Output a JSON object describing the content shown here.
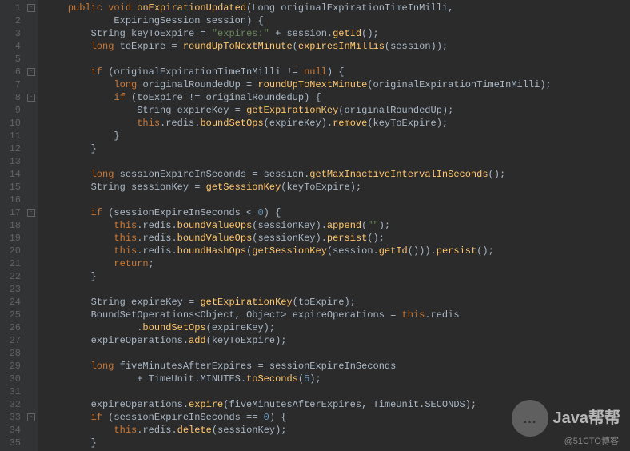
{
  "lineCount": 35,
  "foldMarks": [
    {
      "line": 1,
      "glyph": "-"
    },
    {
      "line": 6,
      "glyph": "-"
    },
    {
      "line": 8,
      "glyph": "-"
    },
    {
      "line": 17,
      "glyph": "-"
    },
    {
      "line": 33,
      "glyph": "-"
    }
  ],
  "code": [
    [
      [
        "    "
      ],
      [
        "kw",
        "public"
      ],
      [
        " "
      ],
      [
        "kw",
        "void"
      ],
      [
        " "
      ],
      [
        "mtd",
        "onExpirationUpdated"
      ],
      [
        "punc",
        "("
      ],
      [
        "cls",
        "Long"
      ],
      [
        " "
      ],
      [
        "param",
        "originalExpirationTimeInMilli"
      ],
      [
        "punc",
        ","
      ]
    ],
    [
      [
        "            "
      ],
      [
        "cls",
        "ExpiringSession"
      ],
      [
        " "
      ],
      [
        "param",
        "session"
      ],
      [
        "punc",
        ") {"
      ]
    ],
    [
      [
        "        "
      ],
      [
        "cls",
        "String"
      ],
      [
        " "
      ],
      [
        "id",
        "keyToExpire"
      ],
      [
        " = "
      ],
      [
        "str",
        "\"expires:\""
      ],
      [
        " + "
      ],
      [
        "id",
        "session"
      ],
      [
        "punc",
        "."
      ],
      [
        "mtd",
        "getId"
      ],
      [
        "punc",
        "();"
      ]
    ],
    [
      [
        "        "
      ],
      [
        "kw",
        "long"
      ],
      [
        " "
      ],
      [
        "id",
        "toExpire"
      ],
      [
        " = "
      ],
      [
        "mtd",
        "roundUpToNextMinute"
      ],
      [
        "punc",
        "("
      ],
      [
        "mtd",
        "expiresInMillis"
      ],
      [
        "punc",
        "("
      ],
      [
        "id",
        "session"
      ],
      [
        "punc",
        "));"
      ]
    ],
    [
      [
        ""
      ]
    ],
    [
      [
        "        "
      ],
      [
        "kw",
        "if"
      ],
      [
        " ("
      ],
      [
        "id",
        "originalExpirationTimeInMilli"
      ],
      [
        " != "
      ],
      [
        "kw",
        "null"
      ],
      [
        "punc",
        ") {"
      ]
    ],
    [
      [
        "            "
      ],
      [
        "kw",
        "long"
      ],
      [
        " "
      ],
      [
        "id",
        "originalRoundedUp"
      ],
      [
        " = "
      ],
      [
        "mtd",
        "roundUpToNextMinute"
      ],
      [
        "punc",
        "("
      ],
      [
        "id",
        "originalExpirationTimeInMilli"
      ],
      [
        "punc",
        ");"
      ]
    ],
    [
      [
        "            "
      ],
      [
        "kw",
        "if"
      ],
      [
        " ("
      ],
      [
        "id",
        "toExpire"
      ],
      [
        " != "
      ],
      [
        "id",
        "originalRoundedUp"
      ],
      [
        "punc",
        ") {"
      ]
    ],
    [
      [
        "                "
      ],
      [
        "cls",
        "String"
      ],
      [
        " "
      ],
      [
        "id",
        "expireKey"
      ],
      [
        " = "
      ],
      [
        "mtd",
        "getExpirationKey"
      ],
      [
        "punc",
        "("
      ],
      [
        "id",
        "originalRoundedUp"
      ],
      [
        "punc",
        ");"
      ]
    ],
    [
      [
        "                "
      ],
      [
        "kw",
        "this"
      ],
      [
        "punc",
        "."
      ],
      [
        "id",
        "redis"
      ],
      [
        "punc",
        "."
      ],
      [
        "mtd",
        "boundSetOps"
      ],
      [
        "punc",
        "("
      ],
      [
        "id",
        "expireKey"
      ],
      [
        "punc",
        ")."
      ],
      [
        "mtd",
        "remove"
      ],
      [
        "punc",
        "("
      ],
      [
        "id",
        "keyToExpire"
      ],
      [
        "punc",
        ");"
      ]
    ],
    [
      [
        "            "
      ],
      [
        "punc",
        "}"
      ]
    ],
    [
      [
        "        "
      ],
      [
        "punc",
        "}"
      ]
    ],
    [
      [
        ""
      ]
    ],
    [
      [
        "        "
      ],
      [
        "kw",
        "long"
      ],
      [
        " "
      ],
      [
        "id",
        "sessionExpireInSeconds"
      ],
      [
        " = "
      ],
      [
        "id",
        "session"
      ],
      [
        "punc",
        "."
      ],
      [
        "mtd",
        "getMaxInactiveIntervalInSeconds"
      ],
      [
        "punc",
        "();"
      ]
    ],
    [
      [
        "        "
      ],
      [
        "cls",
        "String"
      ],
      [
        " "
      ],
      [
        "id",
        "sessionKey"
      ],
      [
        " = "
      ],
      [
        "mtd",
        "getSessionKey"
      ],
      [
        "punc",
        "("
      ],
      [
        "id",
        "keyToExpire"
      ],
      [
        "punc",
        ");"
      ]
    ],
    [
      [
        ""
      ]
    ],
    [
      [
        "        "
      ],
      [
        "kw",
        "if"
      ],
      [
        " ("
      ],
      [
        "id",
        "sessionExpireInSeconds"
      ],
      [
        " < "
      ],
      [
        "num",
        "0"
      ],
      [
        "punc",
        ") {"
      ]
    ],
    [
      [
        "            "
      ],
      [
        "kw",
        "this"
      ],
      [
        "punc",
        "."
      ],
      [
        "id",
        "redis"
      ],
      [
        "punc",
        "."
      ],
      [
        "mtd",
        "boundValueOps"
      ],
      [
        "punc",
        "("
      ],
      [
        "id",
        "sessionKey"
      ],
      [
        "punc",
        ")."
      ],
      [
        "mtd",
        "append"
      ],
      [
        "punc",
        "("
      ],
      [
        "str",
        "\"\""
      ],
      [
        "punc",
        ");"
      ]
    ],
    [
      [
        "            "
      ],
      [
        "kw",
        "this"
      ],
      [
        "punc",
        "."
      ],
      [
        "id",
        "redis"
      ],
      [
        "punc",
        "."
      ],
      [
        "mtd",
        "boundValueOps"
      ],
      [
        "punc",
        "("
      ],
      [
        "id",
        "sessionKey"
      ],
      [
        "punc",
        ")."
      ],
      [
        "mtd",
        "persist"
      ],
      [
        "punc",
        "();"
      ]
    ],
    [
      [
        "            "
      ],
      [
        "kw",
        "this"
      ],
      [
        "punc",
        "."
      ],
      [
        "id",
        "redis"
      ],
      [
        "punc",
        "."
      ],
      [
        "mtd",
        "boundHashOps"
      ],
      [
        "punc",
        "("
      ],
      [
        "mtd",
        "getSessionKey"
      ],
      [
        "punc",
        "("
      ],
      [
        "id",
        "session"
      ],
      [
        "punc",
        "."
      ],
      [
        "mtd",
        "getId"
      ],
      [
        "punc",
        "()))."
      ],
      [
        "mtd",
        "persist"
      ],
      [
        "punc",
        "();"
      ]
    ],
    [
      [
        "            "
      ],
      [
        "kw",
        "return"
      ],
      [
        "punc",
        ";"
      ]
    ],
    [
      [
        "        "
      ],
      [
        "punc",
        "}"
      ]
    ],
    [
      [
        ""
      ]
    ],
    [
      [
        "        "
      ],
      [
        "cls",
        "String"
      ],
      [
        " "
      ],
      [
        "id",
        "expireKey"
      ],
      [
        " = "
      ],
      [
        "mtd",
        "getExpirationKey"
      ],
      [
        "punc",
        "("
      ],
      [
        "id",
        "toExpire"
      ],
      [
        "punc",
        ");"
      ]
    ],
    [
      [
        "        "
      ],
      [
        "cls",
        "BoundSetOperations"
      ],
      [
        "punc",
        "<"
      ],
      [
        "cls",
        "Object"
      ],
      [
        "punc",
        ", "
      ],
      [
        "cls",
        "Object"
      ],
      [
        "punc",
        "> "
      ],
      [
        "id",
        "expireOperations"
      ],
      [
        " = "
      ],
      [
        "kw",
        "this"
      ],
      [
        "punc",
        "."
      ],
      [
        "id",
        "redis"
      ]
    ],
    [
      [
        "                "
      ],
      [
        "punc",
        "."
      ],
      [
        "mtd",
        "boundSetOps"
      ],
      [
        "punc",
        "("
      ],
      [
        "id",
        "expireKey"
      ],
      [
        "punc",
        ");"
      ]
    ],
    [
      [
        "        "
      ],
      [
        "id",
        "expireOperations"
      ],
      [
        "punc",
        "."
      ],
      [
        "mtd",
        "add"
      ],
      [
        "punc",
        "("
      ],
      [
        "id",
        "keyToExpire"
      ],
      [
        "punc",
        ");"
      ]
    ],
    [
      [
        ""
      ]
    ],
    [
      [
        "        "
      ],
      [
        "kw",
        "long"
      ],
      [
        " "
      ],
      [
        "id",
        "fiveMinutesAfterExpires"
      ],
      [
        " = "
      ],
      [
        "id",
        "sessionExpireInSeconds"
      ]
    ],
    [
      [
        "                + "
      ],
      [
        "cls",
        "TimeUnit"
      ],
      [
        "punc",
        "."
      ],
      [
        "id",
        "MINUTES"
      ],
      [
        "punc",
        "."
      ],
      [
        "mtd",
        "toSeconds"
      ],
      [
        "punc",
        "("
      ],
      [
        "num",
        "5"
      ],
      [
        "punc",
        ");"
      ]
    ],
    [
      [
        ""
      ]
    ],
    [
      [
        "        "
      ],
      [
        "id",
        "expireOperations"
      ],
      [
        "punc",
        "."
      ],
      [
        "mtd",
        "expire"
      ],
      [
        "punc",
        "("
      ],
      [
        "id",
        "fiveMinutesAfterExpires"
      ],
      [
        "punc",
        ", "
      ],
      [
        "cls",
        "TimeUnit"
      ],
      [
        "punc",
        "."
      ],
      [
        "id",
        "SECONDS"
      ],
      [
        "punc",
        ");"
      ]
    ],
    [
      [
        "        "
      ],
      [
        "kw",
        "if"
      ],
      [
        " ("
      ],
      [
        "id",
        "sessionExpireInSeconds"
      ],
      [
        " == "
      ],
      [
        "num",
        "0"
      ],
      [
        "punc",
        ") {"
      ]
    ],
    [
      [
        "            "
      ],
      [
        "kw",
        "this"
      ],
      [
        "punc",
        "."
      ],
      [
        "id",
        "redis"
      ],
      [
        "punc",
        "."
      ],
      [
        "mtd",
        "delete"
      ],
      [
        "punc",
        "("
      ],
      [
        "id",
        "sessionKey"
      ],
      [
        "punc",
        ");"
      ]
    ],
    [
      [
        "        "
      ],
      [
        "punc",
        "}"
      ]
    ]
  ],
  "watermark": {
    "icon": "…",
    "text": "Java帮帮",
    "sub": "@51CTO博客"
  }
}
